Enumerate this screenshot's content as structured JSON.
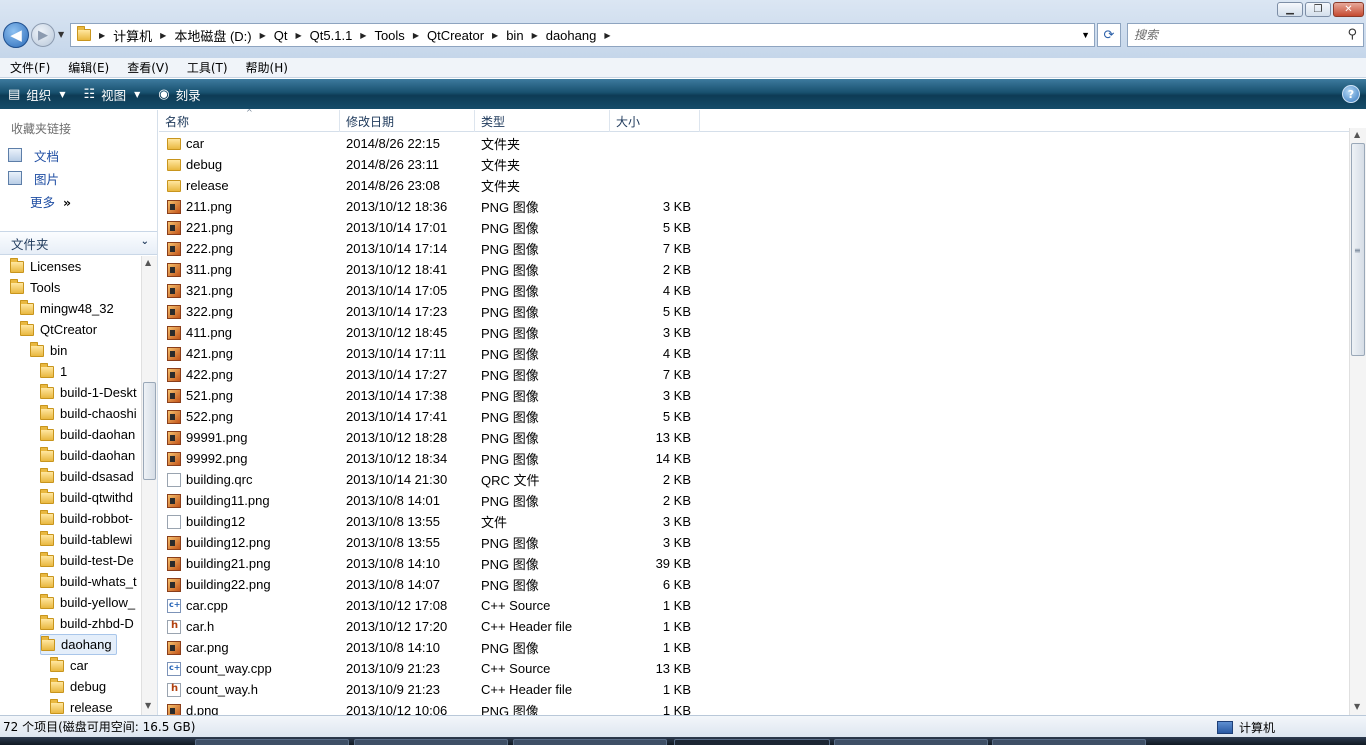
{
  "window": {
    "min_glyph": "▁",
    "max_glyph": "❐",
    "close_glyph": "✕"
  },
  "nav": {
    "back_glyph": "◀",
    "forward_glyph": "▶",
    "dropdown_glyph": "▼"
  },
  "breadcrumbs": [
    "计算机",
    "本地磁盘 (D:)",
    "Qt",
    "Qt5.1.1",
    "Tools",
    "QtCreator",
    "bin",
    "daohang"
  ],
  "search": {
    "placeholder": "搜索"
  },
  "menu": [
    "文件(F)",
    "编辑(E)",
    "查看(V)",
    "工具(T)",
    "帮助(H)"
  ],
  "commands": {
    "organize": "组织",
    "views": "视图",
    "burn": "刻录",
    "help_glyph": "?"
  },
  "favorites": {
    "title": "收藏夹链接",
    "items": [
      "文档",
      "图片"
    ],
    "more": "更多",
    "more_chevron": "»"
  },
  "folders": {
    "title": "文件夹",
    "tree": [
      {
        "label": "Licenses",
        "level": 0
      },
      {
        "label": "Tools",
        "level": 0
      },
      {
        "label": "mingw48_32",
        "level": 1
      },
      {
        "label": "QtCreator",
        "level": 1
      },
      {
        "label": "bin",
        "level": 2
      },
      {
        "label": "1",
        "level": 3
      },
      {
        "label": "build-1-Deskt",
        "level": 3
      },
      {
        "label": "build-chaoshi",
        "level": 3
      },
      {
        "label": "build-daohan",
        "level": 3
      },
      {
        "label": "build-daohan",
        "level": 3
      },
      {
        "label": "build-dsasad",
        "level": 3
      },
      {
        "label": "build-qtwithd",
        "level": 3
      },
      {
        "label": "build-robbot-",
        "level": 3
      },
      {
        "label": "build-tablewi",
        "level": 3
      },
      {
        "label": "build-test-De",
        "level": 3
      },
      {
        "label": "build-whats_t",
        "level": 3
      },
      {
        "label": "build-yellow_",
        "level": 3
      },
      {
        "label": "build-zhbd-D",
        "level": 3
      },
      {
        "label": "daohang",
        "level": 3,
        "selected": true
      },
      {
        "label": "car",
        "level": 4
      },
      {
        "label": "debug",
        "level": 4
      },
      {
        "label": "release",
        "level": 4
      }
    ]
  },
  "columns": {
    "name": "名称",
    "date": "修改日期",
    "type": "类型",
    "size": "大小"
  },
  "files": [
    {
      "name": "car",
      "date": "2014/8/26 22:15",
      "type": "文件夹",
      "size": "",
      "icon": "folder"
    },
    {
      "name": "debug",
      "date": "2014/8/26 23:11",
      "type": "文件夹",
      "size": "",
      "icon": "folder"
    },
    {
      "name": "release",
      "date": "2014/8/26 23:08",
      "type": "文件夹",
      "size": "",
      "icon": "folder"
    },
    {
      "name": "211.png",
      "date": "2013/10/12 18:36",
      "type": "PNG 图像",
      "size": "3 KB",
      "icon": "png"
    },
    {
      "name": "221.png",
      "date": "2013/10/14 17:01",
      "type": "PNG 图像",
      "size": "5 KB",
      "icon": "png"
    },
    {
      "name": "222.png",
      "date": "2013/10/14 17:14",
      "type": "PNG 图像",
      "size": "7 KB",
      "icon": "png"
    },
    {
      "name": "311.png",
      "date": "2013/10/12 18:41",
      "type": "PNG 图像",
      "size": "2 KB",
      "icon": "png"
    },
    {
      "name": "321.png",
      "date": "2013/10/14 17:05",
      "type": "PNG 图像",
      "size": "4 KB",
      "icon": "png"
    },
    {
      "name": "322.png",
      "date": "2013/10/14 17:23",
      "type": "PNG 图像",
      "size": "5 KB",
      "icon": "png"
    },
    {
      "name": "411.png",
      "date": "2013/10/12 18:45",
      "type": "PNG 图像",
      "size": "3 KB",
      "icon": "png"
    },
    {
      "name": "421.png",
      "date": "2013/10/14 17:11",
      "type": "PNG 图像",
      "size": "4 KB",
      "icon": "png"
    },
    {
      "name": "422.png",
      "date": "2013/10/14 17:27",
      "type": "PNG 图像",
      "size": "7 KB",
      "icon": "png"
    },
    {
      "name": "521.png",
      "date": "2013/10/14 17:38",
      "type": "PNG 图像",
      "size": "3 KB",
      "icon": "png"
    },
    {
      "name": "522.png",
      "date": "2013/10/14 17:41",
      "type": "PNG 图像",
      "size": "5 KB",
      "icon": "png"
    },
    {
      "name": "99991.png",
      "date": "2013/10/12 18:28",
      "type": "PNG 图像",
      "size": "13 KB",
      "icon": "png"
    },
    {
      "name": "99992.png",
      "date": "2013/10/12 18:34",
      "type": "PNG 图像",
      "size": "14 KB",
      "icon": "png"
    },
    {
      "name": "building.qrc",
      "date": "2013/10/14 21:30",
      "type": "QRC 文件",
      "size": "2 KB",
      "icon": "file"
    },
    {
      "name": "building11.png",
      "date": "2013/10/8 14:01",
      "type": "PNG 图像",
      "size": "2 KB",
      "icon": "png"
    },
    {
      "name": "building12",
      "date": "2013/10/8 13:55",
      "type": "文件",
      "size": "3 KB",
      "icon": "file"
    },
    {
      "name": "building12.png",
      "date": "2013/10/8 13:55",
      "type": "PNG 图像",
      "size": "3 KB",
      "icon": "png"
    },
    {
      "name": "building21.png",
      "date": "2013/10/8 14:10",
      "type": "PNG 图像",
      "size": "39 KB",
      "icon": "png"
    },
    {
      "name": "building22.png",
      "date": "2013/10/8 14:07",
      "type": "PNG 图像",
      "size": "6 KB",
      "icon": "png"
    },
    {
      "name": "car.cpp",
      "date": "2013/10/12 17:08",
      "type": "C++ Source",
      "size": "1 KB",
      "icon": "cpp"
    },
    {
      "name": "car.h",
      "date": "2013/10/12 17:20",
      "type": "C++ Header file",
      "size": "1 KB",
      "icon": "hdr"
    },
    {
      "name": "car.png",
      "date": "2013/10/8 14:10",
      "type": "PNG 图像",
      "size": "1 KB",
      "icon": "png"
    },
    {
      "name": "count_way.cpp",
      "date": "2013/10/9 21:23",
      "type": "C++ Source",
      "size": "13 KB",
      "icon": "cpp"
    },
    {
      "name": "count_way.h",
      "date": "2013/10/9 21:23",
      "type": "C++ Header file",
      "size": "1 KB",
      "icon": "hdr"
    },
    {
      "name": "d.png",
      "date": "2013/10/12 10:06",
      "type": "PNG 图像",
      "size": "1 KB",
      "icon": "png"
    }
  ],
  "status": {
    "items_text": "72 个项目(磁盘可用空间: 16.5 GB)",
    "location": "计算机"
  }
}
